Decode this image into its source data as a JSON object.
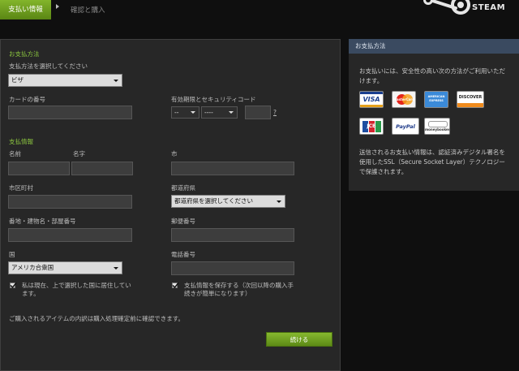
{
  "tabs": {
    "active_label": "支払い情報",
    "next_label": "確認と購入"
  },
  "brand": {
    "name": "STEAM"
  },
  "payment": {
    "section_title": "お支払方法",
    "select_label": "支払方法を選択してください",
    "select_value": "ビザ",
    "card_number_label": "カードの番号",
    "expiry_label": "有効期限とセキュリティコード",
    "expiry_month": "--",
    "expiry_year": "----",
    "cvv_help": "?"
  },
  "billing": {
    "section_title": "支払情報",
    "first_name_label": "名前",
    "last_name_label": "名字",
    "city_label": "市",
    "district_label": "市区町村",
    "prefecture_label": "都道府県",
    "prefecture_value": "都道府県を選択してください",
    "address_label": "番地・建物名・部屋番号",
    "postal_label": "郵便番号",
    "country_label": "国",
    "country_value": "アメリカ合衆国",
    "phone_label": "電話番号",
    "reside_checkbox_label": "私は現在、上で選択した国に居住しています。",
    "save_checkbox_label": "支払情報を保存する（次回以降の購入手続きが簡単になります）",
    "confirm_note": "ご購入されるアイテムの内訳は購入処理確定前に確認できます。",
    "continue_button": "続ける"
  },
  "sidebar": {
    "title": "お支払方法",
    "intro": "お支払いには、安全性の高い次の方法がご利用いただけます。",
    "cards": {
      "visa": "VISA",
      "mastercard": "MasterCard",
      "amex": "AMERICAN EXPRESS",
      "discover": "DISCOVER",
      "jcb": "JCB",
      "paypal": "PayPal",
      "moneybookers": "moneybookers"
    },
    "security_note": "送信されるお支払い情報は、認証済みデジタル署名を使用したSSL（Secure Socket Layer）テクノロジーで保護されます。"
  },
  "colors": {
    "accent_green": "#8bc53f",
    "sidebar_header": "#3a4a60",
    "panel_bg": "#272727"
  }
}
